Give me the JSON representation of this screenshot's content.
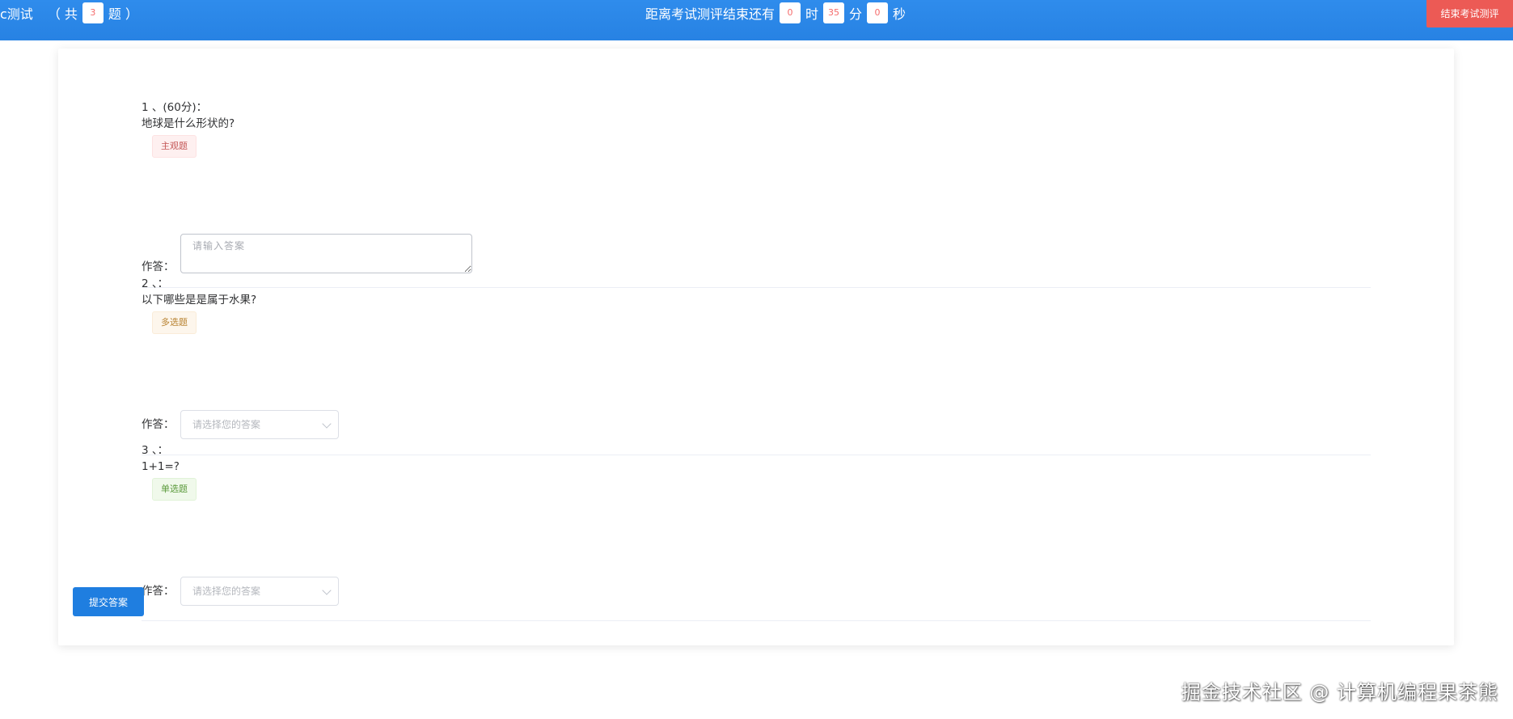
{
  "header": {
    "title": "c测试",
    "count_prefix": "（ 共",
    "question_count": "3",
    "count_suffix": "题 ）",
    "timer_prefix": "距离考试测评结束还有",
    "hours": "0",
    "hours_unit": "时",
    "minutes": "35",
    "minutes_unit": "分",
    "seconds": "0",
    "seconds_unit": "秒",
    "end_button_label": "结束考试测评"
  },
  "questions": [
    {
      "header": "1 、(60分)：",
      "text": "地球是什么形状的?",
      "tag": "主观题",
      "answer_label": "作答：",
      "placeholder": "请输入答案"
    },
    {
      "header": "2 、：",
      "text": "以下哪些是是属于水果?",
      "tag": "多选题",
      "answer_label": "作答：",
      "placeholder": "请选择您的答案"
    },
    {
      "header": "3 、：",
      "text": "1+1=?",
      "tag": "单选题",
      "answer_label": "作答：",
      "placeholder": "请选择您的答案"
    }
  ],
  "submit_label": "提交答案",
  "watermark": "掘金技术社区 @ 计算机编程果茶熊",
  "colors": {
    "header_bg": "#2b85e4",
    "end_button": "#ec5a55",
    "submit_button": "#1f7ee0"
  }
}
